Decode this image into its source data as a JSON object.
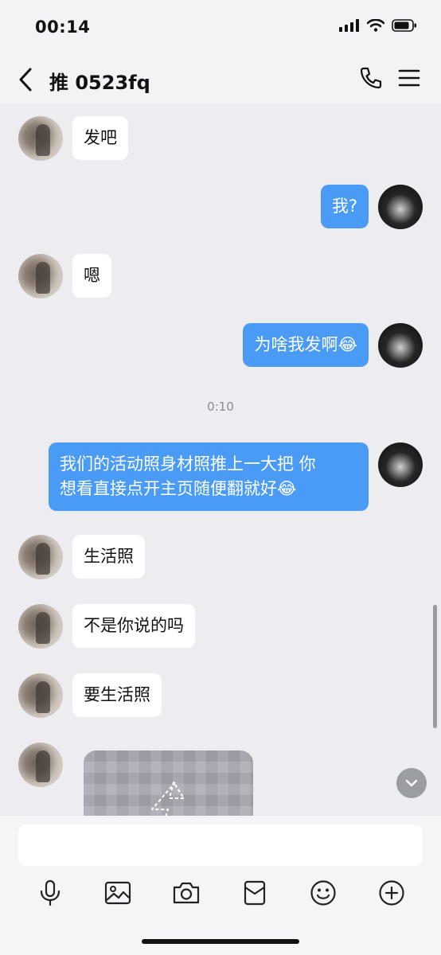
{
  "status_bar": {
    "time": "00:14"
  },
  "nav": {
    "title": "推 0523fq"
  },
  "timestamp": "0:10",
  "messages": [
    {
      "from": "them",
      "text": "发吧"
    },
    {
      "from": "me",
      "text": "我?"
    },
    {
      "from": "them",
      "text": "嗯"
    },
    {
      "from": "me",
      "text": "为啥我发啊😂"
    },
    {
      "from": "me",
      "text": "我们的活动照身材照推上一大把 你\n想看直接点开主页随便翻就好😂"
    },
    {
      "from": "them",
      "text": "生活照"
    },
    {
      "from": "them",
      "text": "不是你说的吗"
    },
    {
      "from": "them",
      "text": "要生活照"
    }
  ],
  "input": {
    "value": "",
    "placeholder": ""
  },
  "toolbar_icons": [
    "microphone-icon",
    "image-icon",
    "camera-icon",
    "red-packet-icon",
    "emoji-icon",
    "plus-icon"
  ],
  "colors": {
    "my_bubble": "#4a9bf5",
    "their_bubble": "#ffffff",
    "chat_bg": "#ececf1"
  }
}
